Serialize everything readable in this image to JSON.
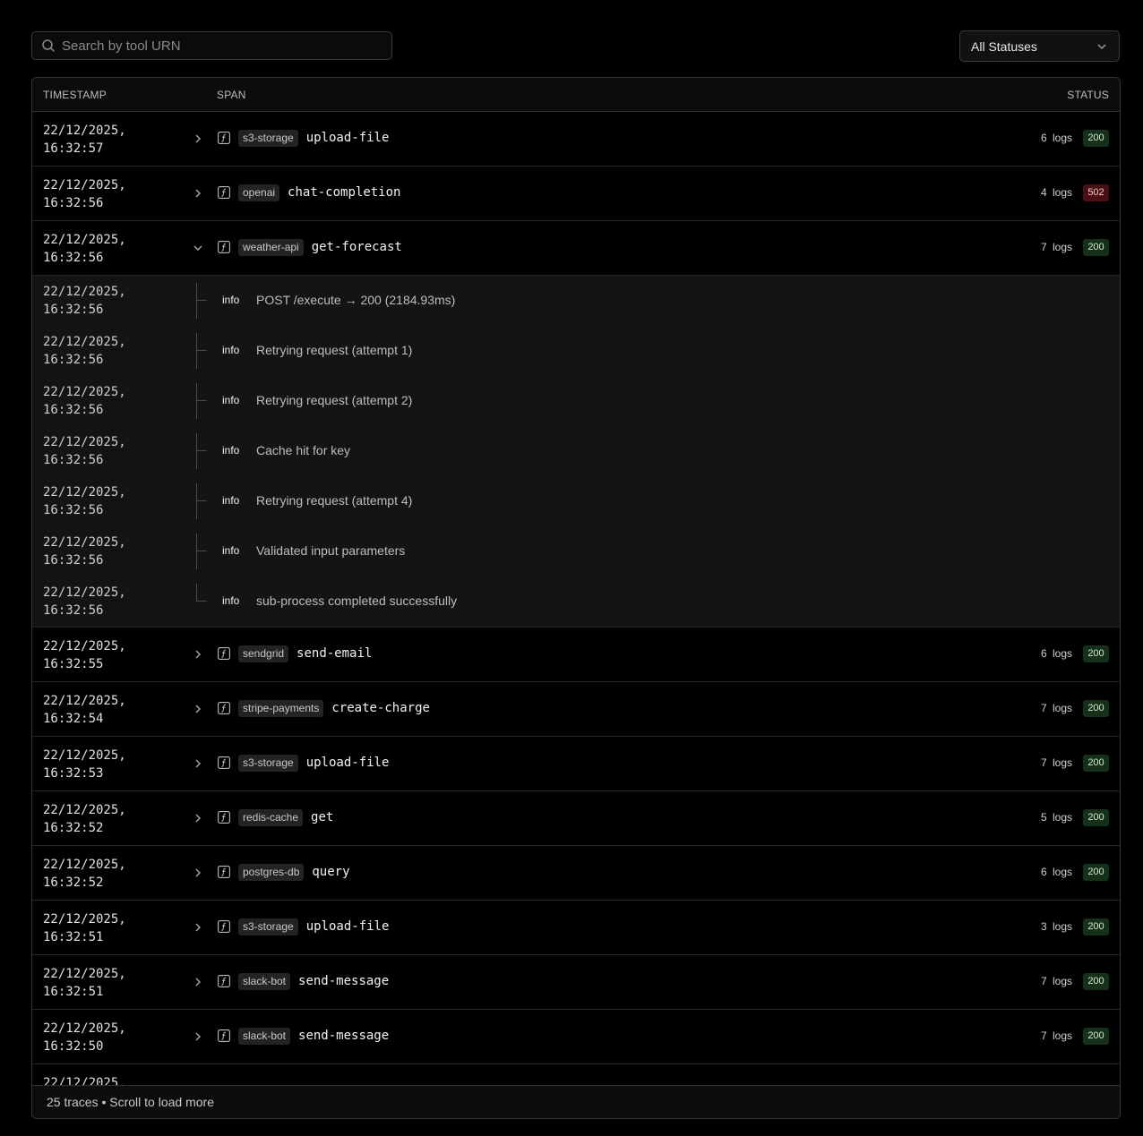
{
  "search": {
    "placeholder": "Search by tool URN"
  },
  "status_filter": {
    "selected": "All Statuses"
  },
  "table": {
    "headers": {
      "timestamp": "TIMESTAMP",
      "span": "SPAN",
      "status": "STATUS"
    },
    "rows": [
      {
        "ts": "22/12/2025,\n16:32:57",
        "tag": "s3-storage",
        "name": "upload-file",
        "logs": "6 logs",
        "code": "200",
        "expanded": false
      },
      {
        "ts": "22/12/2025,\n16:32:56",
        "tag": "openai",
        "name": "chat-completion",
        "logs": "4 logs",
        "code": "502",
        "expanded": false
      },
      {
        "ts": "22/12/2025,\n16:32:56",
        "tag": "weather-api",
        "name": "get-forecast",
        "logs": "7 logs",
        "code": "200",
        "expanded": true,
        "children": [
          {
            "ts": "22/12/2025,\n16:32:56",
            "level": "info",
            "msg": "POST /execute → 200 (2184.93ms)"
          },
          {
            "ts": "22/12/2025,\n16:32:56",
            "level": "info",
            "msg": "Retrying request (attempt 1)"
          },
          {
            "ts": "22/12/2025,\n16:32:56",
            "level": "info",
            "msg": "Retrying request (attempt 2)"
          },
          {
            "ts": "22/12/2025,\n16:32:56",
            "level": "info",
            "msg": "Cache hit for key"
          },
          {
            "ts": "22/12/2025,\n16:32:56",
            "level": "info",
            "msg": "Retrying request (attempt 4)"
          },
          {
            "ts": "22/12/2025,\n16:32:56",
            "level": "info",
            "msg": "Validated input parameters"
          },
          {
            "ts": "22/12/2025,\n16:32:56",
            "level": "info",
            "msg": "sub-process completed successfully"
          }
        ]
      },
      {
        "ts": "22/12/2025,\n16:32:55",
        "tag": "sendgrid",
        "name": "send-email",
        "logs": "6 logs",
        "code": "200",
        "expanded": false
      },
      {
        "ts": "22/12/2025,\n16:32:54",
        "tag": "stripe-payments",
        "name": "create-charge",
        "logs": "7 logs",
        "code": "200",
        "expanded": false
      },
      {
        "ts": "22/12/2025,\n16:32:53",
        "tag": "s3-storage",
        "name": "upload-file",
        "logs": "7 logs",
        "code": "200",
        "expanded": false
      },
      {
        "ts": "22/12/2025,\n16:32:52",
        "tag": "redis-cache",
        "name": "get",
        "logs": "5 logs",
        "code": "200",
        "expanded": false
      },
      {
        "ts": "22/12/2025,\n16:32:52",
        "tag": "postgres-db",
        "name": "query",
        "logs": "6 logs",
        "code": "200",
        "expanded": false
      },
      {
        "ts": "22/12/2025,\n16:32:51",
        "tag": "s3-storage",
        "name": "upload-file",
        "logs": "3 logs",
        "code": "200",
        "expanded": false
      },
      {
        "ts": "22/12/2025,\n16:32:51",
        "tag": "slack-bot",
        "name": "send-message",
        "logs": "7 logs",
        "code": "200",
        "expanded": false
      },
      {
        "ts": "22/12/2025,\n16:32:50",
        "tag": "slack-bot",
        "name": "send-message",
        "logs": "7 logs",
        "code": "200",
        "expanded": false
      },
      {
        "ts": "22/12/2025,",
        "tag": "",
        "name": "",
        "logs": "",
        "code": "",
        "expanded": false,
        "partial": true
      }
    ]
  },
  "footer": {
    "text": "25 traces • Scroll to load more"
  },
  "colors": {
    "ok_badge": "#17301a",
    "error_badge": "#4a0f12",
    "expanded_bg": "#141414"
  },
  "icons": [
    "search-icon",
    "chevron-down-icon",
    "chevron-right-icon",
    "function-icon"
  ]
}
